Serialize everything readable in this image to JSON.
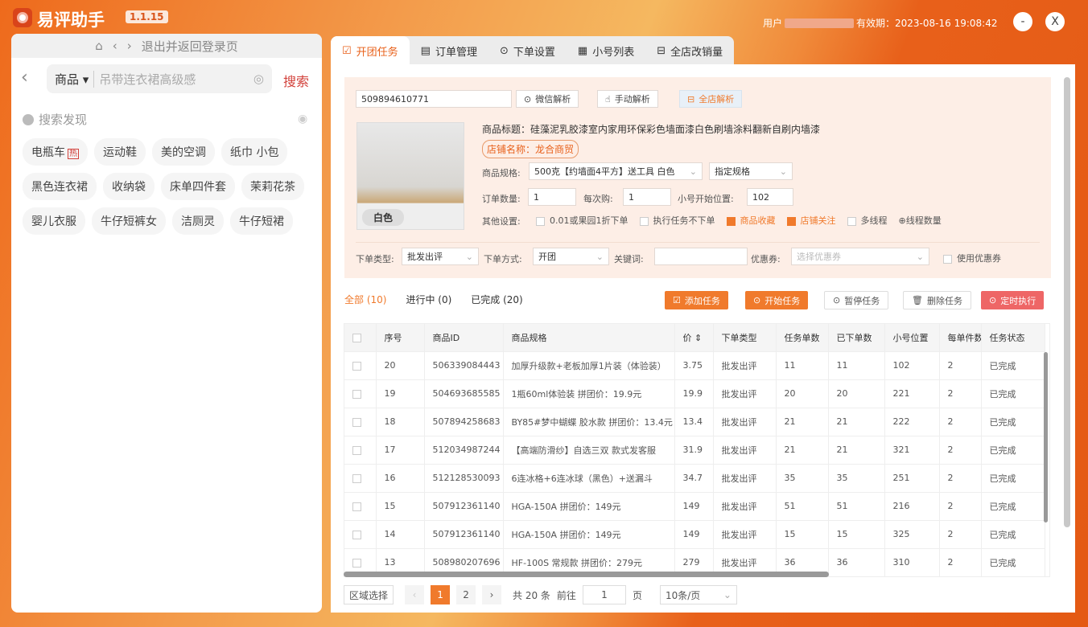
{
  "app": {
    "name": "易评助手",
    "version": "1.1.15",
    "user_label": "用户",
    "expiry": "有效期：2023-08-16 19:08:42",
    "minimize": "-",
    "close": "X"
  },
  "left": {
    "nav_text": "退出并返回登录页",
    "search_category": "商品",
    "search_placeholder": "吊带连衣裙高级感",
    "search_button": "搜索",
    "discover_title": "搜索发现",
    "hot_badge": "热",
    "chips": [
      "电瓶车",
      "运动鞋",
      "美的空调",
      "纸巾 小包",
      "黑色连衣裙",
      "收纳袋",
      "床单四件套",
      "茉莉花茶",
      "婴儿衣服",
      "牛仔短裤女",
      "洁厕灵",
      "牛仔短裙"
    ]
  },
  "tabs": [
    {
      "label": "开团任务",
      "icon": "checkbox-icon"
    },
    {
      "label": "订单管理",
      "icon": "document-icon"
    },
    {
      "label": "下单设置",
      "icon": "settings-icon"
    },
    {
      "label": "小号列表",
      "icon": "grid-icon"
    },
    {
      "label": "全店改销量",
      "icon": "store-icon"
    }
  ],
  "config": {
    "product_id": "509894610771",
    "wechat_parse": "微信解析",
    "manual_parse": "手动解析",
    "store_parse": "全店解析",
    "title_label": "商品标题：",
    "title": "硅藻泥乳胶漆室内家用环保彩色墙面漆白色刷墙涂料翻新自刷内墙漆",
    "store_name": "店铺名称：龙合商贸",
    "image_tag": "白色",
    "spec_label": "商品规格:",
    "spec_value": "500克【约墙面4平方】送工具 白色",
    "spec_mode": "指定规格",
    "qty_label": "订单数量:",
    "qty": "1",
    "per_label": "每次购:",
    "per": "1",
    "start_label": "小号开始位置:",
    "start": "102",
    "other_label": "其他设置:",
    "options": [
      {
        "label": "0.01或果园1折下单",
        "checked": false
      },
      {
        "label": "执行任务不下单",
        "checked": false
      },
      {
        "label": "商品收藏",
        "checked": true
      },
      {
        "label": "店铺关注",
        "checked": true
      },
      {
        "label": "多线程",
        "checked": false
      }
    ],
    "thread_count": "⊕线程数量",
    "type_label": "下单类型:",
    "type_value": "批发出评",
    "mode_label": "下单方式:",
    "mode_value": "开团",
    "keyword_label": "关键词:",
    "keyword": "",
    "coupon_label": "优惠券:",
    "coupon_placeholder": "选择优惠券",
    "use_coupon": "使用优惠券"
  },
  "tasks": {
    "filters": [
      "全部 (10)",
      "进行中 (0)",
      "已完成 (20)"
    ],
    "add": "添加任务",
    "start": "开始任务",
    "pause": "暂停任务",
    "delete": "删除任务",
    "schedule": "定时执行",
    "columns": [
      "序号",
      "商品ID",
      "商品规格",
      "价",
      "下单类型",
      "任务单数",
      "已下单数",
      "小号位置",
      "每单件数",
      "任务状态"
    ],
    "rows": [
      [
        "20",
        "506339084443",
        "加厚升级款+老板加厚1片装（体验装）",
        "3.75",
        "批发出评",
        "11",
        "11",
        "102",
        "2",
        "已完成"
      ],
      [
        "19",
        "504693685585",
        "1瓶60ml体验装 拼团价：19.9元",
        "19.9",
        "批发出评",
        "20",
        "20",
        "221",
        "2",
        "已完成"
      ],
      [
        "18",
        "507894258683",
        "BY85#梦中蝴蝶 胶水款 拼团价：13.4元",
        "13.4",
        "批发出评",
        "21",
        "21",
        "222",
        "2",
        "已完成"
      ],
      [
        "17",
        "512034987244",
        "【高端防滑纱】自选三双 款式发客服",
        "31.9",
        "批发出评",
        "21",
        "21",
        "321",
        "2",
        "已完成"
      ],
      [
        "16",
        "512128530093",
        "6连冰格+6连冰球（黑色）+送漏斗",
        "34.7",
        "批发出评",
        "35",
        "35",
        "251",
        "2",
        "已完成"
      ],
      [
        "15",
        "507912361140",
        "HGA-150A 拼团价：149元",
        "149",
        "批发出评",
        "51",
        "51",
        "216",
        "2",
        "已完成"
      ],
      [
        "14",
        "507912361140",
        "HGA-150A 拼团价：149元",
        "149",
        "批发出评",
        "15",
        "15",
        "325",
        "2",
        "已完成"
      ],
      [
        "13",
        "508980207696",
        "HF-100S 常规款 拼团价：279元",
        "279",
        "批发出评",
        "36",
        "36",
        "310",
        "2",
        "已完成"
      ]
    ]
  },
  "pager": {
    "region": "区域选择",
    "pages": [
      "1",
      "2"
    ],
    "total": "共 20 条",
    "goto": "前往",
    "page_value": "1",
    "page_unit": "页",
    "page_size": "10条/页"
  },
  "colors": {
    "accent": "#f07a2c",
    "danger": "#ee6666"
  }
}
